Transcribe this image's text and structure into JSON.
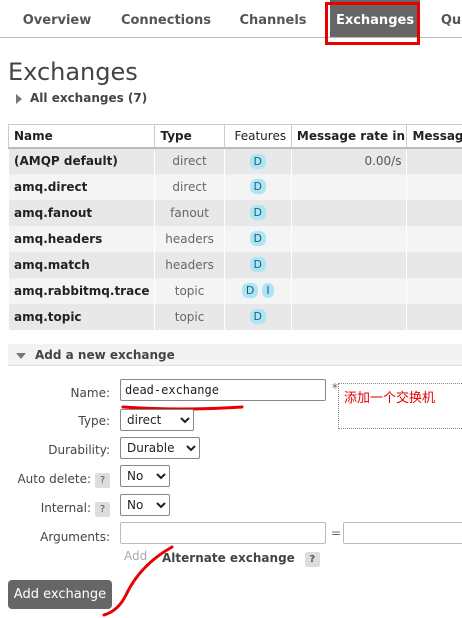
{
  "tabs": [
    "Overview",
    "Connections",
    "Channels",
    "Exchanges",
    "Qu"
  ],
  "page_title": "Exchanges",
  "all_exchanges_toggle": "All exchanges (7)",
  "table": {
    "headers": [
      "Name",
      "Type",
      "Features",
      "Message rate in",
      "Message"
    ],
    "rows": [
      {
        "name": "(AMQP default)",
        "type": "direct",
        "features": [
          "D"
        ],
        "rate_in": "0.00/s"
      },
      {
        "name": "amq.direct",
        "type": "direct",
        "features": [
          "D"
        ],
        "rate_in": ""
      },
      {
        "name": "amq.fanout",
        "type": "fanout",
        "features": [
          "D"
        ],
        "rate_in": ""
      },
      {
        "name": "amq.headers",
        "type": "headers",
        "features": [
          "D"
        ],
        "rate_in": ""
      },
      {
        "name": "amq.match",
        "type": "headers",
        "features": [
          "D"
        ],
        "rate_in": ""
      },
      {
        "name": "amq.rabbitmq.trace",
        "type": "topic",
        "features": [
          "D",
          "I"
        ],
        "rate_in": ""
      },
      {
        "name": "amq.topic",
        "type": "topic",
        "features": [
          "D"
        ],
        "rate_in": ""
      }
    ]
  },
  "add_section": {
    "title": "Add a new exchange",
    "name_label": "Name:",
    "name_value": "dead-exchange",
    "required_mark": "*",
    "annotation": "添加一个交换机",
    "type_label": "Type:",
    "type_value": "direct",
    "durability_label": "Durability:",
    "durability_value": "Durable",
    "auto_delete_label": "Auto delete:",
    "auto_delete_value": "No",
    "internal_label": "Internal:",
    "internal_value": "No",
    "arguments_label": "Arguments:",
    "help_mark": "?",
    "equals": "=",
    "add_link": "Add",
    "alternate_exchange": "Alternate exchange",
    "submit": "Add exchange"
  },
  "colors": {
    "highlight": "#e60000",
    "active_tab": "#666666",
    "badge": "#aee5f5"
  }
}
